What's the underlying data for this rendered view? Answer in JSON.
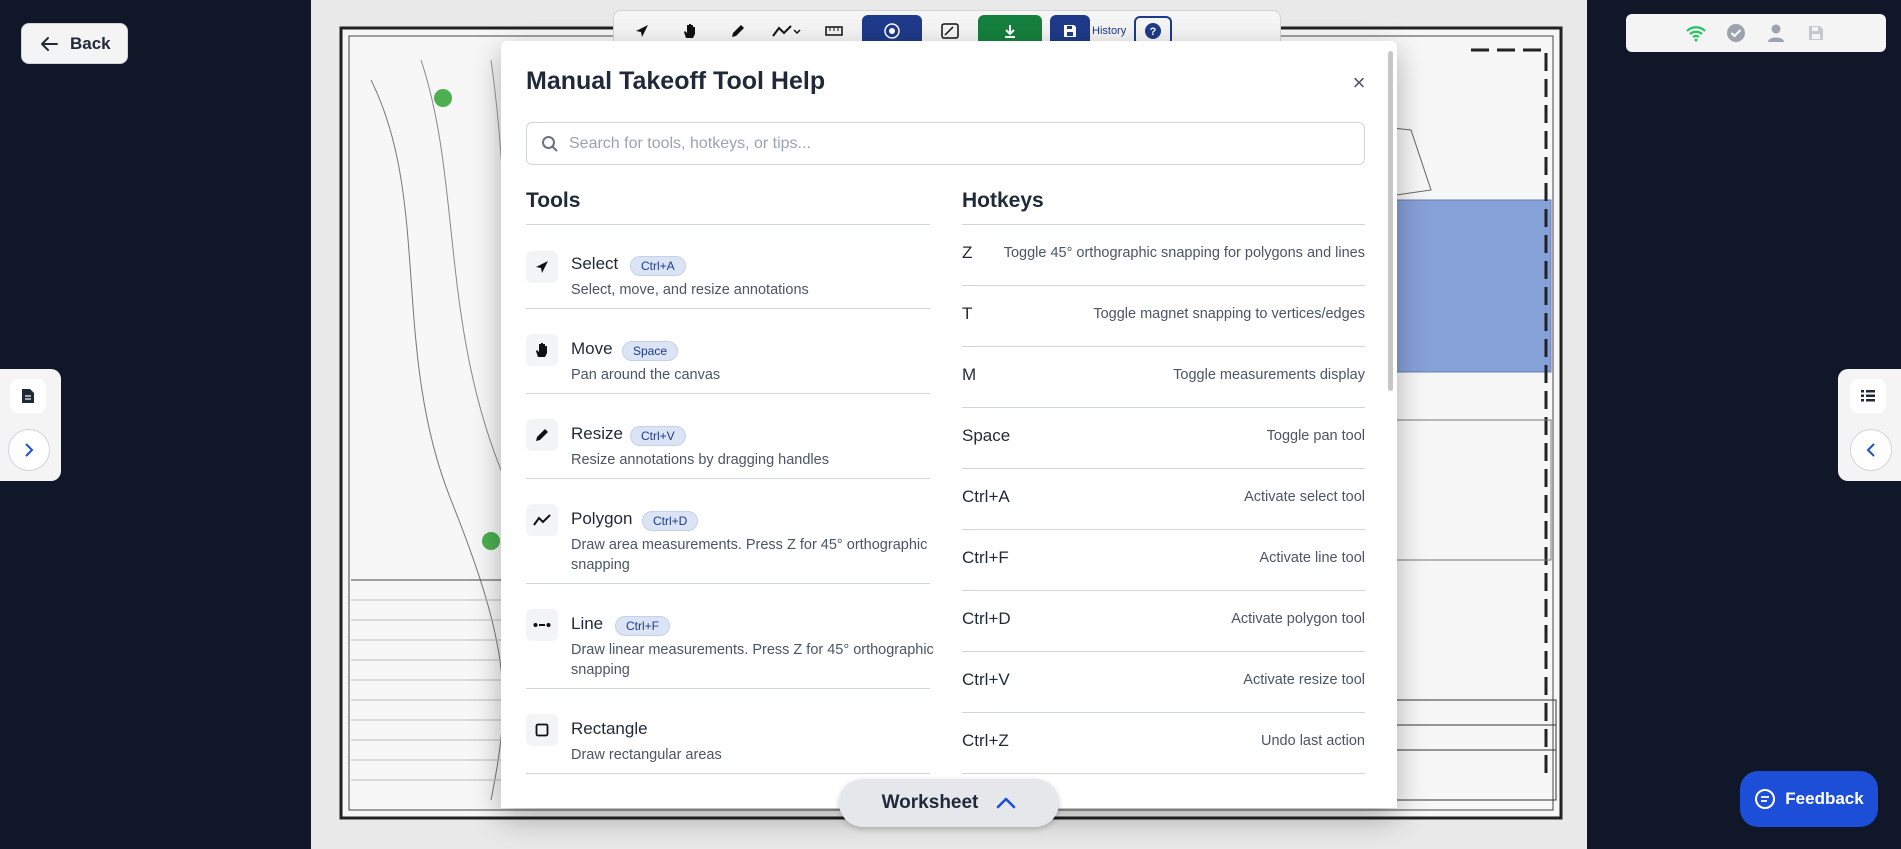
{
  "back_button": {
    "label": "Back"
  },
  "toolbar": {
    "history_label": "History"
  },
  "modal": {
    "title": "Manual Takeoff Tool Help",
    "close_symbol": "×",
    "search_placeholder": "Search for tools, hotkeys, or tips...",
    "tools_heading": "Tools",
    "hotkeys_heading": "Hotkeys",
    "tools": [
      {
        "name": "Select",
        "hotkey": "Ctrl+A",
        "description": "Select, move, and resize annotations",
        "icon": "cursor-arrow-icon"
      },
      {
        "name": "Move",
        "hotkey": "Space",
        "description": "Pan around the canvas",
        "icon": "hand-icon"
      },
      {
        "name": "Resize",
        "hotkey": "Ctrl+V",
        "description": "Resize annotations by dragging handles",
        "icon": "pencil-icon"
      },
      {
        "name": "Polygon",
        "hotkey": "Ctrl+D",
        "description": "Draw area measurements. Press Z for 45° orthographic snapping",
        "icon": "polyline-icon"
      },
      {
        "name": "Line",
        "hotkey": "Ctrl+F",
        "description": "Draw linear measurements. Press Z for 45° orthographic snapping",
        "icon": "dashed-line-icon"
      },
      {
        "name": "Rectangle",
        "hotkey": "",
        "description": "Draw rectangular areas",
        "icon": "square-icon"
      }
    ],
    "hotkeys": [
      {
        "key": "Z",
        "description": "Toggle 45° orthographic snapping for polygons and lines"
      },
      {
        "key": "T",
        "description": "Toggle magnet snapping to vertices/edges"
      },
      {
        "key": "M",
        "description": "Toggle measurements display"
      },
      {
        "key": "Space",
        "description": "Toggle pan tool"
      },
      {
        "key": "Ctrl+A",
        "description": "Activate select tool"
      },
      {
        "key": "Ctrl+F",
        "description": "Activate line tool"
      },
      {
        "key": "Ctrl+D",
        "description": "Activate polygon tool"
      },
      {
        "key": "Ctrl+V",
        "description": "Activate resize tool"
      },
      {
        "key": "Ctrl+Z",
        "description": "Undo last action"
      }
    ]
  },
  "worksheet": {
    "label": "Worksheet"
  },
  "feedback": {
    "label": "Feedback"
  },
  "colors": {
    "accent": "#1e3a8a",
    "feedback_bg": "#1d4ed8",
    "save_green": "#15803d",
    "badge_bg": "#dbe4f5"
  }
}
